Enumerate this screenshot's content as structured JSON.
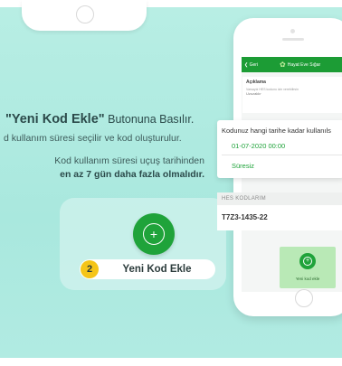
{
  "headline": {
    "quoted": "\"Yeni Kod Ekle\"",
    "rest": " Butonuna Basılır."
  },
  "subline": "d kullanım süresi seçilir ve kod oluşturulur.",
  "description": {
    "line1": "Kod kullanım süresi uçuş tarihinden",
    "line2": "en az 7 gün daha fazla olmalıdır."
  },
  "step": {
    "number": "2",
    "label": "Yeni Kod Ekle"
  },
  "phone": {
    "nav": {
      "back_label": "❮ Geri",
      "title": "Hayat Eve Sığar"
    },
    "description_card": {
      "label": "Açıklama",
      "hint": "Varsayılı HES kodunu izin verebilirsin",
      "value": "Uzuzaklır"
    },
    "popup": {
      "question": "Kodunuz hangi tarihe kadar kullanıls",
      "date_option": "01-07-2020 00:00",
      "indefinite_option": "Süresiz"
    },
    "hes_codes": {
      "header": "HES KODLARIM",
      "code": "T7Z3-1435-22"
    },
    "add_button_label": "Yeni kod ekle"
  },
  "colors": {
    "background": "#b8eee4",
    "brand_green": "#1fa33a",
    "step_yellow": "#f5c518"
  }
}
